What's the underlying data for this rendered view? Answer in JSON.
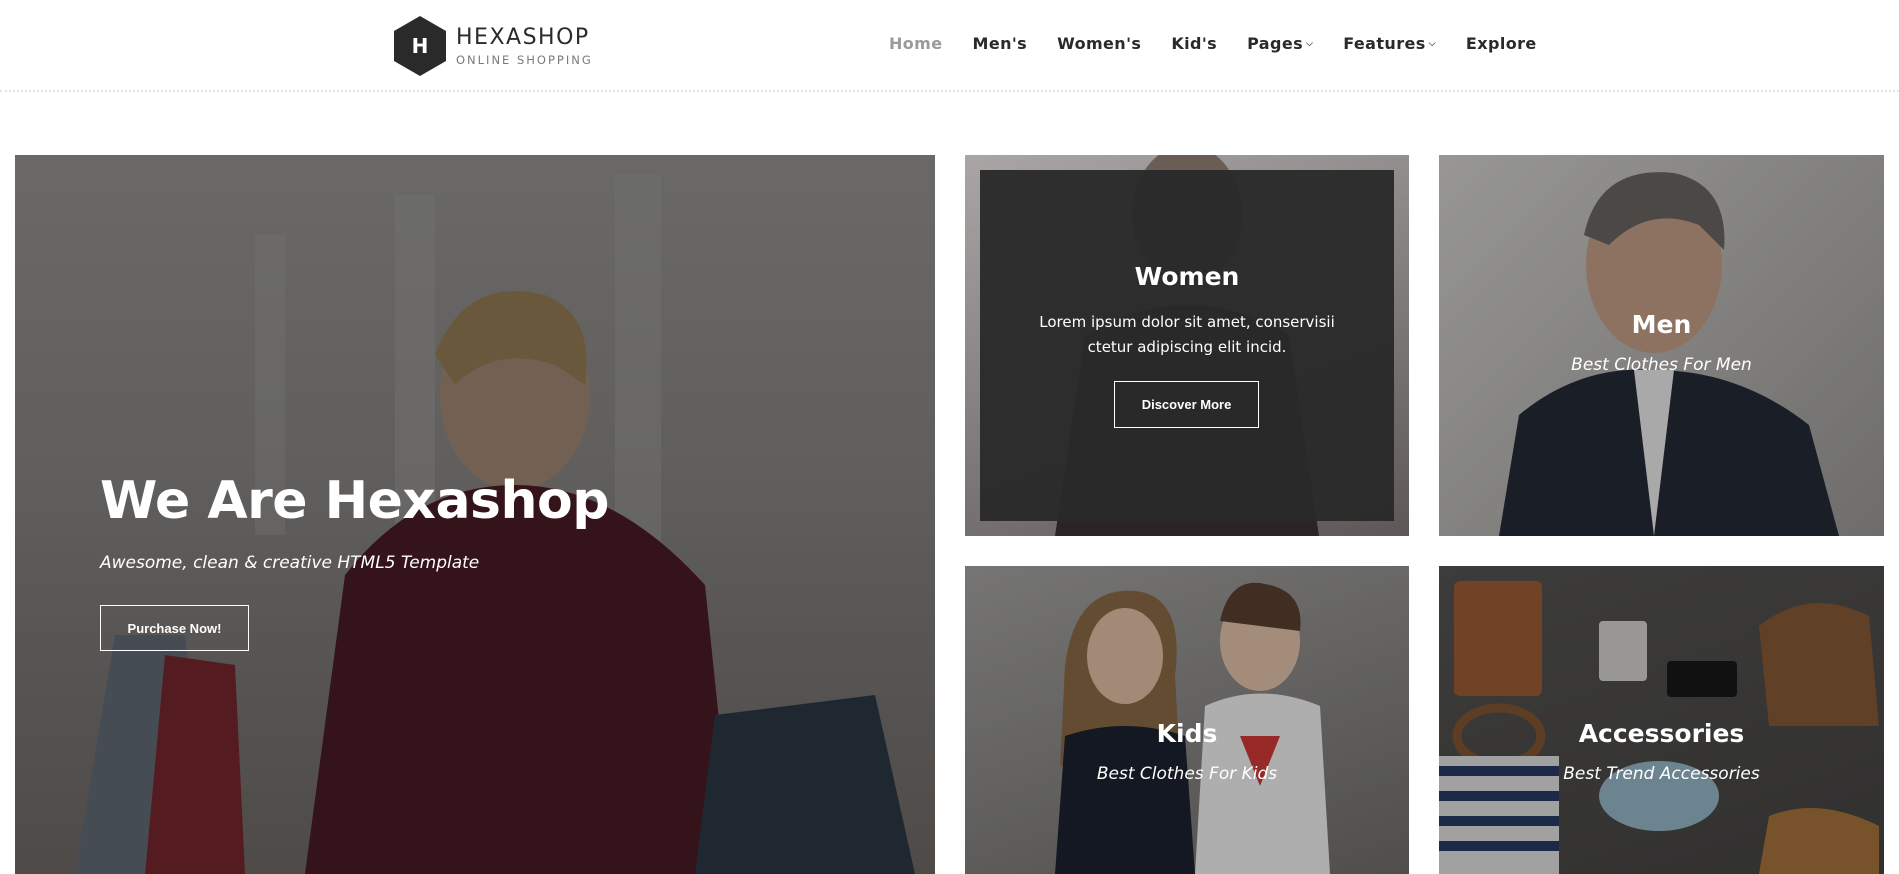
{
  "logo": {
    "mark": "H",
    "title": "HEXASHOP",
    "subtitle": "ONLINE SHOPPING"
  },
  "nav": {
    "items": [
      {
        "label": "Home",
        "active": true
      },
      {
        "label": "Men's"
      },
      {
        "label": "Women's"
      },
      {
        "label": "Kid's"
      },
      {
        "label": "Pages",
        "dropdown": true
      },
      {
        "label": "Features",
        "dropdown": true
      },
      {
        "label": "Explore"
      }
    ],
    "caret_icon": "chevron-down-icon"
  },
  "hero": {
    "title": "We Are Hexashop",
    "subtitle": "Awesome, clean & creative HTML5 Template",
    "button": "Purchase Now!"
  },
  "women": {
    "title": "Women",
    "text": "Lorem ipsum dolor sit amet, conservisii ctetur adipiscing elit incid.",
    "button": "Discover More"
  },
  "men": {
    "title": "Men",
    "subtitle": "Best Clothes For Men"
  },
  "kids": {
    "title": "Kids",
    "subtitle": "Best Clothes For Kids"
  },
  "accessories": {
    "title": "Accessories",
    "subtitle": "Best Trend Accessories"
  }
}
